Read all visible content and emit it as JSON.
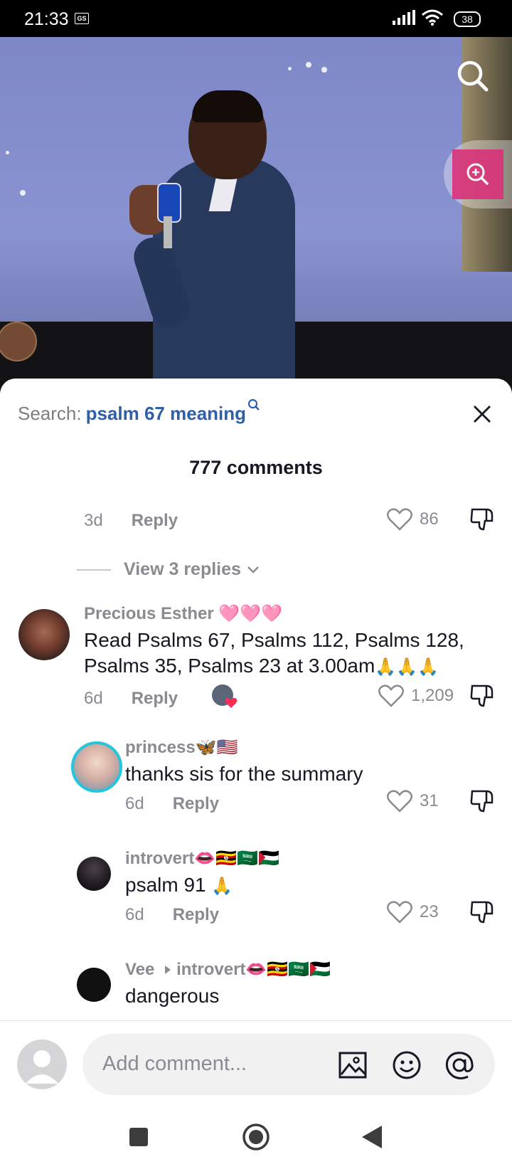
{
  "status_bar": {
    "time": "21:33",
    "battery": "38"
  },
  "search": {
    "label": "Search:",
    "query": "psalm 67 meaning"
  },
  "comments_header": {
    "count_label": "777 comments"
  },
  "comments": [
    {
      "time": "3d",
      "reply_label": "Reply",
      "likes": "86"
    },
    {
      "view_replies": "View 3 replies"
    },
    {
      "username": "Precious Esther",
      "username_emoji": "🩷🩷🩷",
      "text": "Read Psalms 67, Psalms 112, Psalms 128, Psalms 35, Psalms 23 at 3.00am",
      "text_emoji": "🙏🙏🙏",
      "time": "6d",
      "reply_label": "Reply",
      "likes": "1,209"
    },
    {
      "username": "princess",
      "username_emoji": "🦋🇺🇸",
      "text": "thanks sis for the summary",
      "time": "6d",
      "reply_label": "Reply",
      "likes": "31"
    },
    {
      "username": "introvert",
      "username_emoji": "👄🇺🇬🇸🇦🇵🇸",
      "text": "psalm 91",
      "text_emoji": "🙏",
      "time": "6d",
      "reply_label": "Reply",
      "likes": "23"
    },
    {
      "username": "Vee",
      "reply_to": "introvert",
      "reply_to_emoji": "👄🇺🇬🇸🇦🇵🇸",
      "text": "dangerous"
    }
  ],
  "composer": {
    "placeholder": "Add comment..."
  },
  "colors": {
    "accent_link": "#2f5fa8",
    "muted_text": "#8a8b91",
    "zoom_button": "#d9327a"
  },
  "icons": [
    "gs-icon",
    "signal-icon",
    "wifi-icon",
    "battery-icon",
    "search-icon",
    "zoom-in-icon",
    "search-small-icon",
    "close-icon",
    "chevron-down-icon",
    "heart-icon",
    "dislike-icon",
    "image-icon",
    "emoji-icon",
    "mention-icon",
    "recent-apps-icon",
    "home-icon",
    "back-icon"
  ]
}
